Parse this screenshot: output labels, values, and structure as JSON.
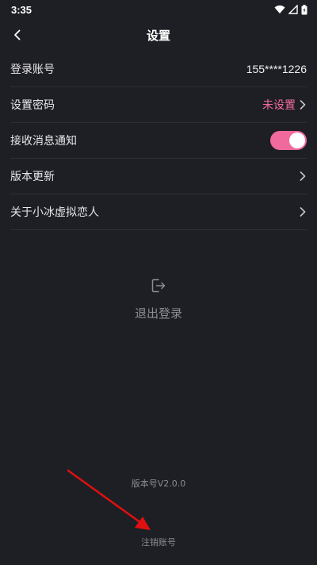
{
  "status_bar": {
    "time": "3:35",
    "icons": [
      "wifi-icon",
      "signal-icon",
      "battery-icon"
    ]
  },
  "header": {
    "title": "设置",
    "back_icon": "chevron-left-icon"
  },
  "settings": {
    "login_account": {
      "label": "登录账号",
      "value": "155****1226"
    },
    "set_password": {
      "label": "设置密码",
      "value": "未设置"
    },
    "notifications": {
      "label": "接收消息通知",
      "enabled": true
    },
    "version_update": {
      "label": "版本更新"
    },
    "about": {
      "label": "关于小冰虚拟恋人"
    }
  },
  "logout": {
    "label": "退出登录",
    "icon": "logout-icon"
  },
  "footer": {
    "version": "版本号V2.0.0",
    "cancel_account": "注销账号"
  },
  "colors": {
    "background": "#1e1f24",
    "accent": "#f06a9d",
    "annotation": "#e01010"
  }
}
